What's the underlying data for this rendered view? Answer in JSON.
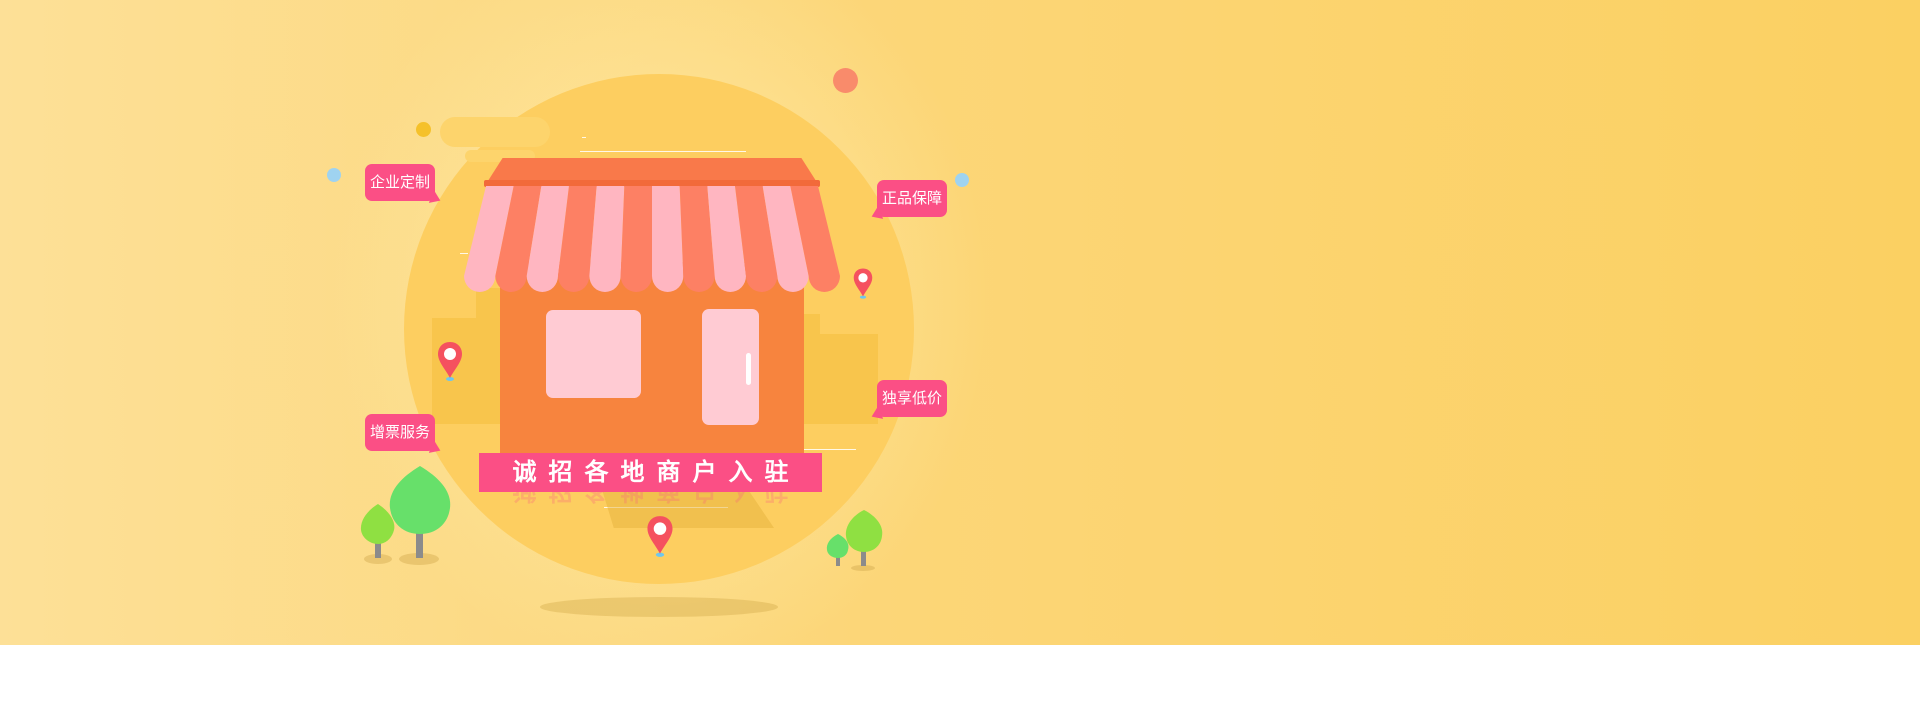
{
  "banner": {
    "sign_text": "诚招各地商户入驻",
    "tags": [
      {
        "label": "企业定制"
      },
      {
        "label": "正品保障"
      },
      {
        "label": "独享低价"
      },
      {
        "label": "增票服务"
      }
    ],
    "icons": [
      "location-pin-icon",
      "tree-icon",
      "storefront-illustration"
    ],
    "colors": {
      "background": "#fcd678",
      "accent_pink": "#fb4f85",
      "store_orange": "#f7843e",
      "awning_pink": "#ffb6c1",
      "awning_coral": "#fd8064",
      "pin_red": "#f5515f",
      "tree_green": "#67e06a"
    }
  }
}
